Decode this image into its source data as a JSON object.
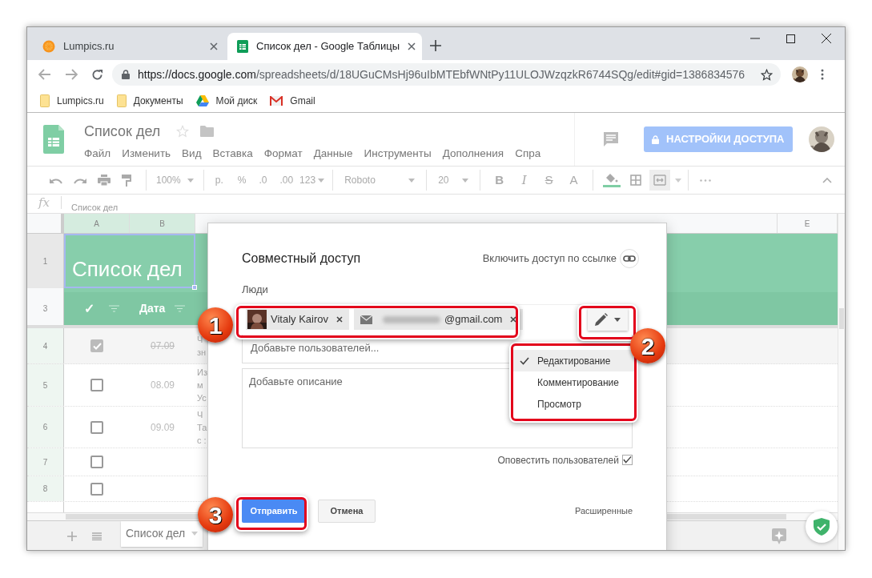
{
  "browser": {
    "tabs": [
      {
        "title": "Lumpics.ru",
        "kind": "site",
        "selected": false
      },
      {
        "title": "Список дел - Google Таблицы",
        "kind": "sheets",
        "selected": true
      }
    ],
    "url_host": "https://docs.google.com",
    "url_path": "/spreadsheets/d/18UGuCMsHj96uIbMTEbfWNtPy11ULOJWzqzkR6744SQg/edit#gid=1386834576",
    "bookmarks": [
      {
        "label": "Lumpics.ru",
        "kind": "folder"
      },
      {
        "label": "Документы",
        "kind": "folder"
      },
      {
        "label": "Мой диск",
        "kind": "drive"
      },
      {
        "label": "Gmail",
        "kind": "gmail"
      }
    ]
  },
  "doc": {
    "title": "Список дел",
    "menus": [
      "Файл",
      "Изменить",
      "Вид",
      "Вставка",
      "Формат",
      "Данные",
      "Инструменты",
      "Дополнения",
      "Спра"
    ],
    "share_button": "НАСТРОЙКИ ДОСТУПА"
  },
  "toolbar": {
    "zoom": "100%",
    "currency": "р.",
    "percent": "%",
    "decimal_less": ".0",
    "decimal_more": ".00",
    "number_format": "123",
    "font": "Roboto",
    "font_size": "20",
    "format_buttons": [
      {
        "label": "B",
        "kind": "bold"
      },
      {
        "label": "I",
        "kind": "italic"
      },
      {
        "label": "S",
        "kind": "strike"
      },
      {
        "label": "A",
        "kind": "color"
      }
    ]
  },
  "formula_bar": {
    "fx": "fx",
    "value": "Список дел"
  },
  "grid": {
    "columns": [
      {
        "label": "A",
        "selected": true
      },
      {
        "label": "B",
        "selected": true
      },
      {
        "label": "E",
        "selected": false
      }
    ],
    "title_row": {
      "number": "1",
      "text": "Список дел"
    },
    "header_row": {
      "number": "3",
      "check": "✓",
      "date": "Дата"
    },
    "task_rows": [
      {
        "number": "4",
        "checked": true,
        "date": "07.09",
        "fragments": [
          "Ч",
          "зн"
        ]
      },
      {
        "number": "5",
        "checked": false,
        "date": "08.09",
        "fragments": [
          "Из",
          "м",
          "Ус"
        ]
      },
      {
        "number": "6",
        "checked": false,
        "date": "09.09",
        "fragments": [
          "Ч",
          "Та",
          "с :"
        ]
      },
      {
        "number": "7",
        "checked": false
      },
      {
        "number": "8",
        "checked": false
      }
    ]
  },
  "sheet_tabs": [
    {
      "label": "Список дел",
      "selected": true
    }
  ],
  "dialog": {
    "title": "Совместный доступ",
    "link_sharing": "Включить доступ по ссылке",
    "people_label": "Люди",
    "chips": [
      {
        "kind": "person",
        "label": "Vitaly Kairov"
      },
      {
        "kind": "email",
        "label": "@gmail.com"
      }
    ],
    "add_placeholder": "Добавьте пользователей...",
    "description_placeholder": "Добавьте описание",
    "notify": {
      "label": "Оповестить пользователей",
      "checked": true
    },
    "permissions": [
      {
        "label": "Редактирование",
        "selected": true
      },
      {
        "label": "Комментирование",
        "selected": false
      },
      {
        "label": "Просмотр",
        "selected": false
      }
    ],
    "send": "Отправить",
    "cancel": "Отмена",
    "advanced": "Расширенные"
  },
  "callouts": [
    {
      "number": "1"
    },
    {
      "number": "2"
    },
    {
      "number": "3"
    }
  ]
}
